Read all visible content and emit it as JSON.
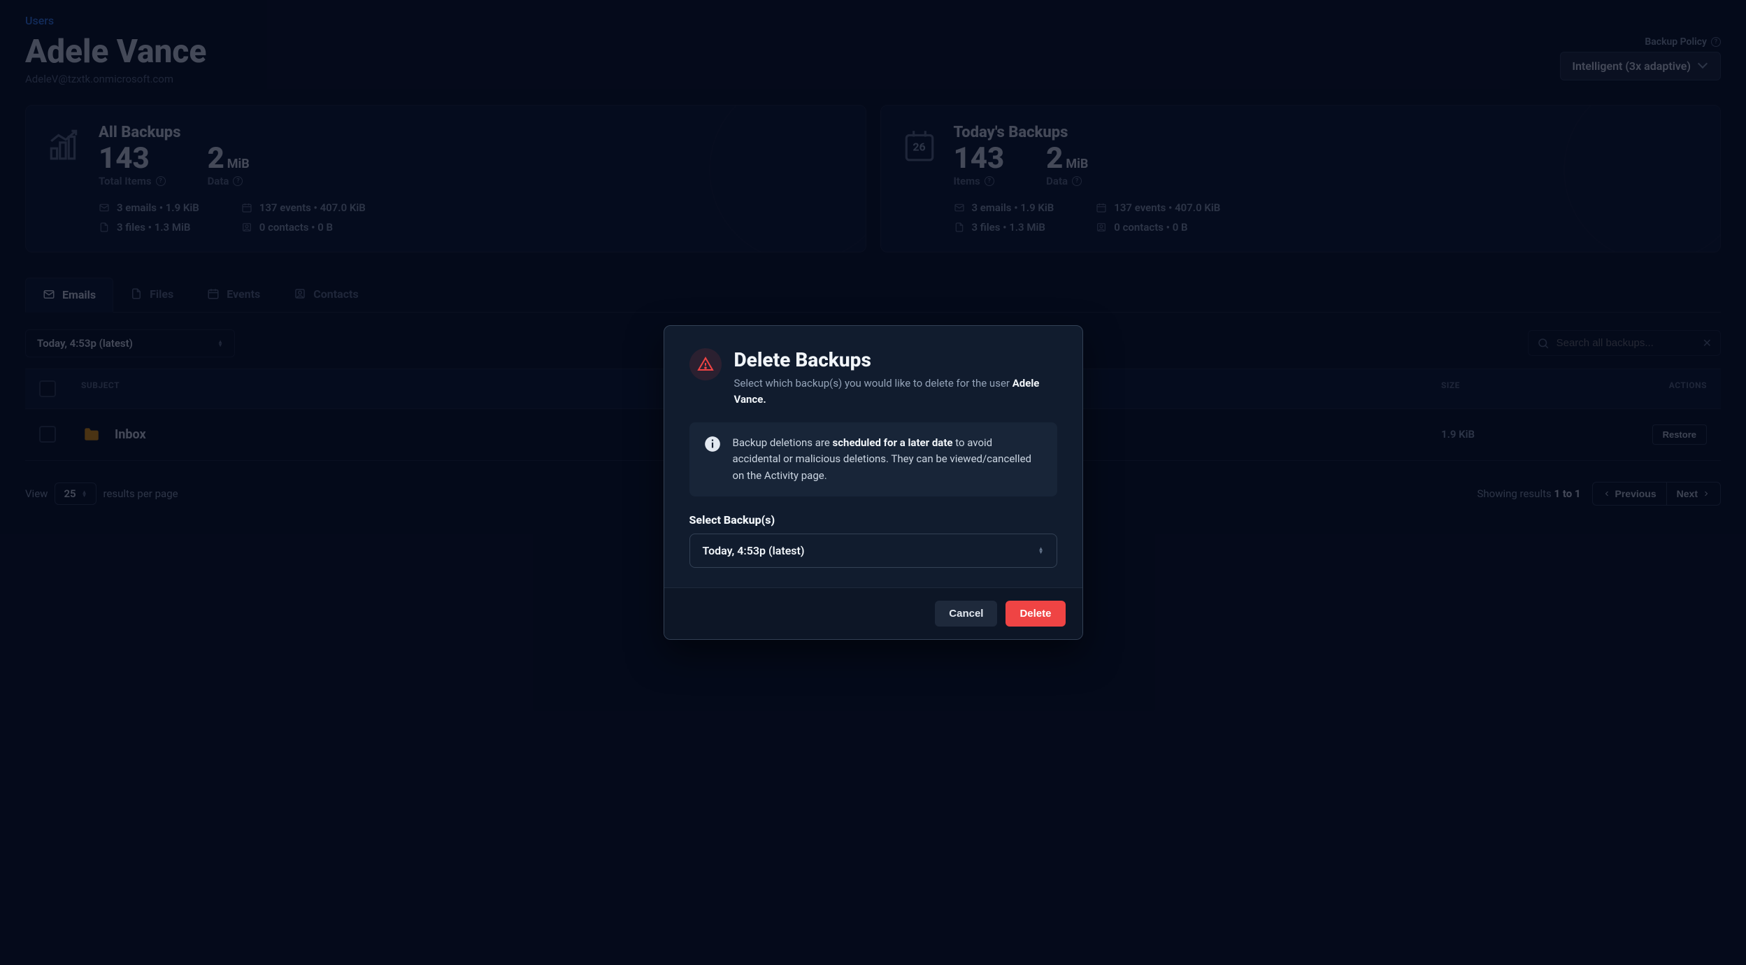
{
  "breadcrumb": "Users",
  "user": {
    "name": "Adele Vance",
    "email": "AdeleV@tzxtk.onmicrosoft.com"
  },
  "policy": {
    "label": "Backup Policy",
    "value": "Intelligent (3x adaptive)"
  },
  "cards": {
    "all": {
      "title": "All Backups",
      "total_value": "143",
      "total_label": "Total Items",
      "data_value": "2",
      "data_unit": "MiB",
      "data_label": "Data",
      "stats": {
        "emails": "3 emails • 1.9 KiB",
        "files": "3 files • 1.3 MiB",
        "events": "137 events • 407.0 KiB",
        "contacts": "0 contacts • 0 B"
      }
    },
    "today": {
      "title": "Today's Backups",
      "cal_day": "26",
      "total_value": "143",
      "total_label": "Items",
      "data_value": "2",
      "data_unit": "MiB",
      "data_label": "Data",
      "stats": {
        "emails": "3 emails • 1.9 KiB",
        "files": "3 files • 1.3 MiB",
        "events": "137 events • 407.0 KiB",
        "contacts": "0 contacts • 0 B"
      }
    }
  },
  "tabs": {
    "emails": "Emails",
    "files": "Files",
    "events": "Events",
    "contacts": "Contacts"
  },
  "snapshot": "Today, 4:53p (latest)",
  "search_placeholder": "Search all backups...",
  "table": {
    "col_subject": "SUBJECT",
    "col_size": "SIZE",
    "col_actions": "ACTIONS",
    "row": {
      "name": "Inbox",
      "size": "1.9 KiB",
      "restore": "Restore"
    }
  },
  "pager": {
    "view": "View",
    "page_size": "25",
    "per_page": "results per page",
    "showing": "Showing results",
    "range": "1 to 1",
    "prev": "Previous",
    "next": "Next"
  },
  "modal": {
    "title": "Delete Backups",
    "subtitle_pre": "Select which backup(s) you would like to delete for the user ",
    "subtitle_user": "Adele Vance.",
    "info_pre": "Backup deletions are ",
    "info_bold": "scheduled for a later date",
    "info_post": " to avoid accidental or malicious deletions. They can be viewed/cancelled on the Activity page.",
    "select_label": "Select Backup(s)",
    "select_value": "Today, 4:53p (latest)",
    "cancel": "Cancel",
    "delete": "Delete"
  }
}
